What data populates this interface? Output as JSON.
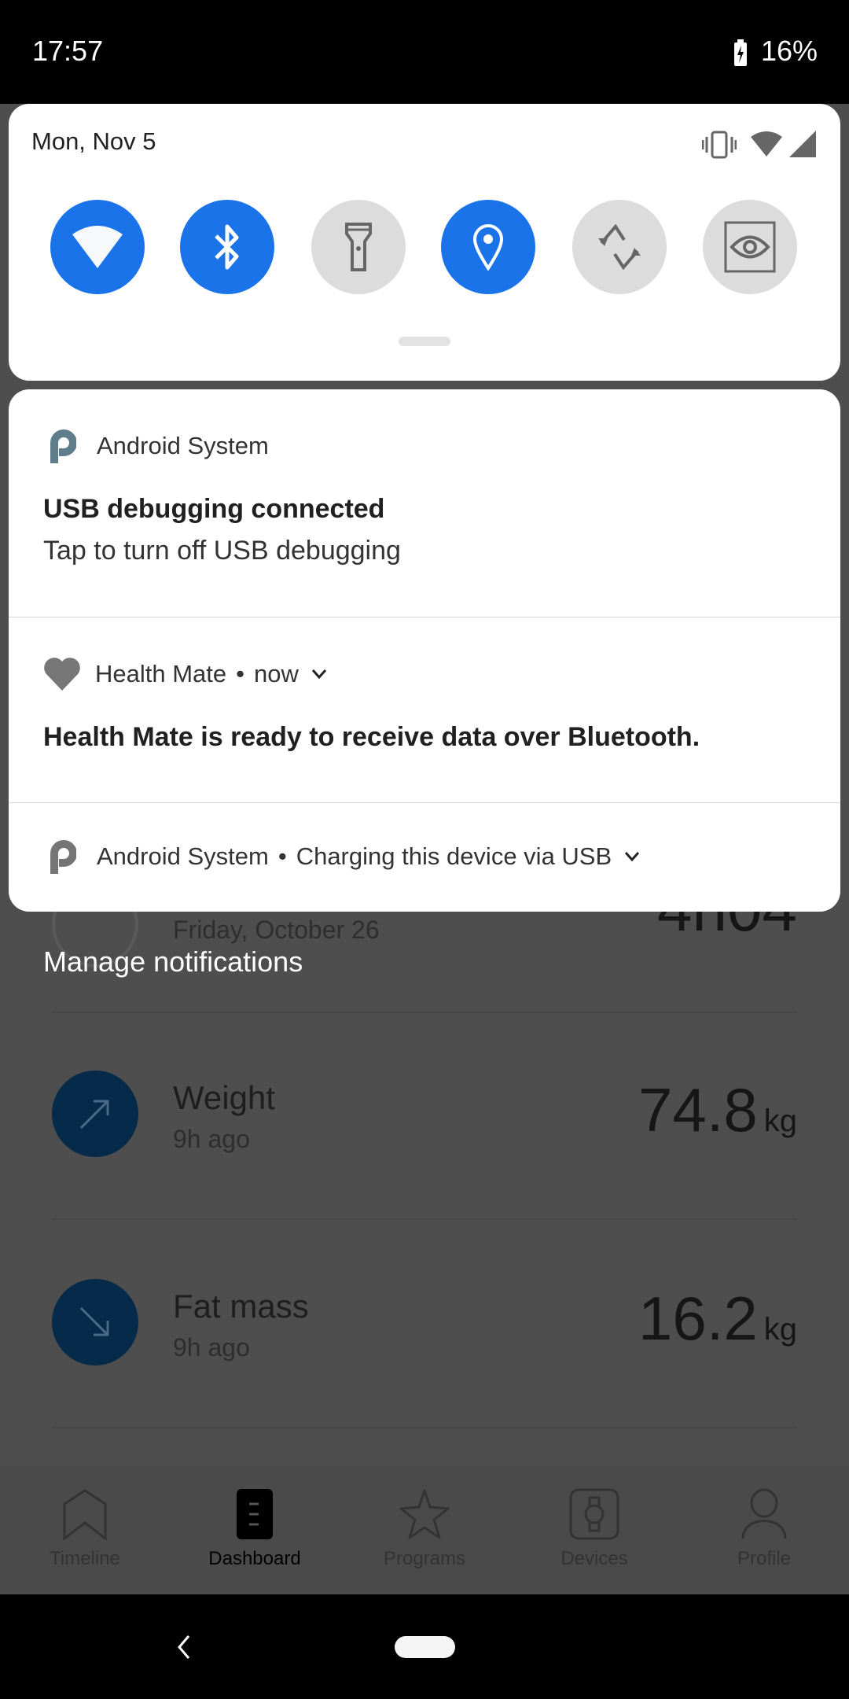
{
  "status_bar": {
    "time": "17:57",
    "battery": "16%"
  },
  "quick_settings": {
    "date": "Mon, Nov 5",
    "tiles": [
      {
        "name": "wifi",
        "icon": "wifi-icon",
        "state": "on"
      },
      {
        "name": "bluetooth",
        "icon": "bluetooth-icon",
        "state": "on"
      },
      {
        "name": "flashlight",
        "icon": "flashlight-icon",
        "state": "off"
      },
      {
        "name": "location",
        "icon": "location-icon",
        "state": "on"
      },
      {
        "name": "auto-rotate",
        "icon": "rotate-icon",
        "state": "off"
      },
      {
        "name": "screen-cast",
        "icon": "eye-icon",
        "state": "off"
      }
    ],
    "accent": "#1a73e8"
  },
  "notifications": [
    {
      "app": "Android System",
      "title": "USB debugging connected",
      "text": "Tap to turn off USB debugging"
    },
    {
      "app": "Health Mate",
      "time": "now",
      "text": "Health Mate is ready to receive data over Bluetooth."
    },
    {
      "app": "Android System",
      "summary": "Charging this device via USB"
    }
  ],
  "separator": "•",
  "manage_label": "Manage notifications",
  "background_app": {
    "partial": {
      "date": "Friday, October 26",
      "value": "4h04"
    },
    "metrics": [
      {
        "title": "Weight",
        "sub": "9h ago",
        "value": "74.8",
        "unit": "kg",
        "trend": "up"
      },
      {
        "title": "Fat mass",
        "sub": "9h ago",
        "value": "16.2",
        "unit": "kg",
        "trend": "down"
      }
    ],
    "nav": [
      {
        "label": "Timeline"
      },
      {
        "label": "Dashboard",
        "active": true
      },
      {
        "label": "Programs"
      },
      {
        "label": "Devices"
      },
      {
        "label": "Profile"
      }
    ]
  }
}
